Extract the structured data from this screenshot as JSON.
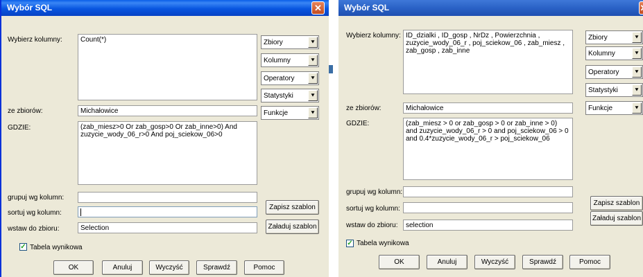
{
  "left": {
    "title": "Wybór SQL",
    "close": "✕",
    "labels": {
      "columns": "Wybierz kolumny:",
      "from": "ze zbiorów:",
      "where": "GDZIE:",
      "group": "grupuj wg kolumn:",
      "sort": "sortuj wg kolumn:",
      "into": "wstaw do zbioru:"
    },
    "values": {
      "columns": "Count(*)",
      "from": "Michałowice",
      "where": "(zab_miesz>0 Or zab_gosp>0 Or zab_inne>0) And zuzycie_wody_06_r>0 And poj_sciekow_06>0",
      "group": "",
      "sort": "",
      "into": "Selection"
    },
    "combos": [
      "Zbiory",
      "Kolumny",
      "Operatory",
      "Statystyki",
      "Funkcje"
    ],
    "combo_arrow": "⯆",
    "save_template": "Zapisz szablon",
    "load_template": "Załaduj szablon",
    "checkbox_label": "Tabela wynikowa",
    "checkbox_mark": "✓",
    "buttons": [
      "OK",
      "Anuluj",
      "Wyczyść",
      "Sprawdź",
      "Pomoc"
    ]
  },
  "right": {
    "title": "Wybór SQL",
    "close": "✕",
    "labels": {
      "columns": "Wybierz kolumny:",
      "from": "ze zbiorów:",
      "where": "GDZIE:",
      "group": "grupuj wg kolumn:",
      "sort": "sortuj wg kolumn:",
      "into": "wstaw do zbioru:"
    },
    "values": {
      "columns": "ID_dzialki , ID_gosp , NrDz , Powierzchnia , zuzycie_wody_06_r , poj_sciekow_06 , zab_miesz , zab_gosp , zab_inne",
      "from": "Michałowice",
      "where": "(zab_miesz > 0 or zab_gosp > 0 or zab_inne > 0) and zuzycie_wody_06_r > 0 and poj_sciekow_06 > 0 and 0.4*zuzycie_wody_06_r > poj_sciekow_06",
      "group": "",
      "sort": "",
      "into": "selection"
    },
    "combos": [
      "Zbiory",
      "Kolumny",
      "Operatory",
      "Statystyki",
      "Funkcje"
    ],
    "combo_arrow": "⯆",
    "save_template": "Zapisz szablon",
    "load_template": "Załaduj szablon",
    "checkbox_label": "Tabela wynikowa",
    "checkbox_mark": "✓",
    "buttons": [
      "OK",
      "Anuluj",
      "Wyczyść",
      "Sprawdź",
      "Pomoc"
    ]
  }
}
